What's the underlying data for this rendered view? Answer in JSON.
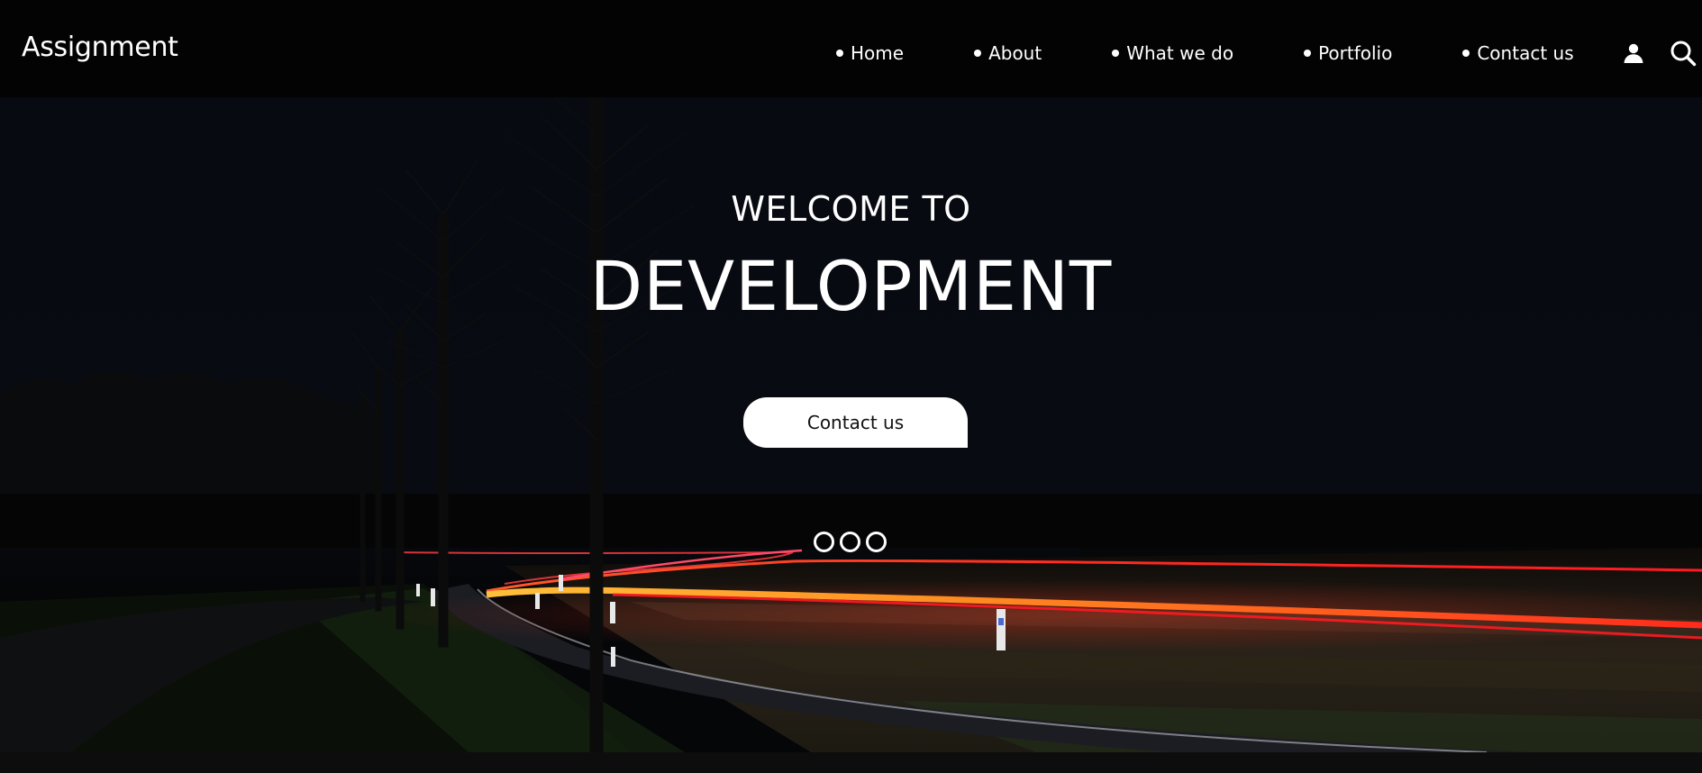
{
  "brand": {
    "name": "Assignment"
  },
  "nav": {
    "items": [
      {
        "label": "Home"
      },
      {
        "label": "About"
      },
      {
        "label": "What we do"
      },
      {
        "label": "Portfolio"
      },
      {
        "label": "Contact us"
      }
    ],
    "icons": [
      "user-icon",
      "search-icon"
    ]
  },
  "hero": {
    "welcome": "WELCOME TO",
    "headline": "DEVELOPMENT",
    "cta_label": "Contact us",
    "slide_count": 3,
    "background": "night road with red and orange light trails"
  },
  "colors": {
    "header_bg": "#030303",
    "text": "#ffffff",
    "button_bg": "#ffffff",
    "button_text": "#111111",
    "light_trail_red": "#ff2a1f",
    "light_trail_orange": "#ffb020"
  }
}
